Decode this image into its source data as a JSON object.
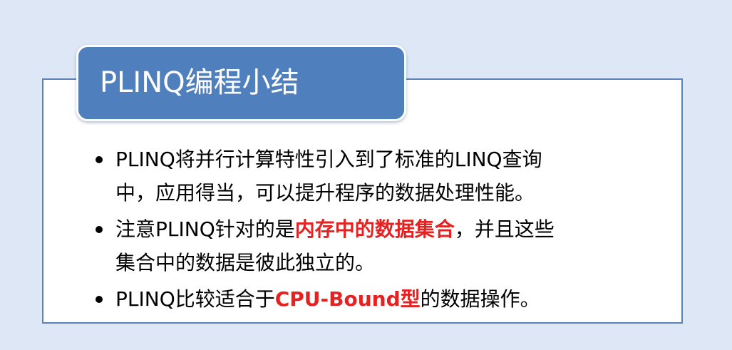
{
  "slide": {
    "title": "PLINQ编程小结",
    "bullets": [
      {
        "line1": "PLINQ将并行计算特性引入到了标准的LINQ查询",
        "line2": "中，应用得当，可以提升程序的数据处理性能。"
      },
      {
        "line1_pre": "注意PLINQ针对的是",
        "line1_hl": "内存中的数据集合",
        "line1_post": "，并且这些",
        "line2": "集合中的数据是彼此独立的。"
      },
      {
        "pre": "PLINQ比较适合于",
        "hl": "CPU-Bound型",
        "post": "的数据操作。"
      }
    ]
  },
  "colors": {
    "background": "#dde7f6",
    "title_tab": "#4f7fbd",
    "box_border": "#5b82b8",
    "highlight": "#e52222"
  }
}
